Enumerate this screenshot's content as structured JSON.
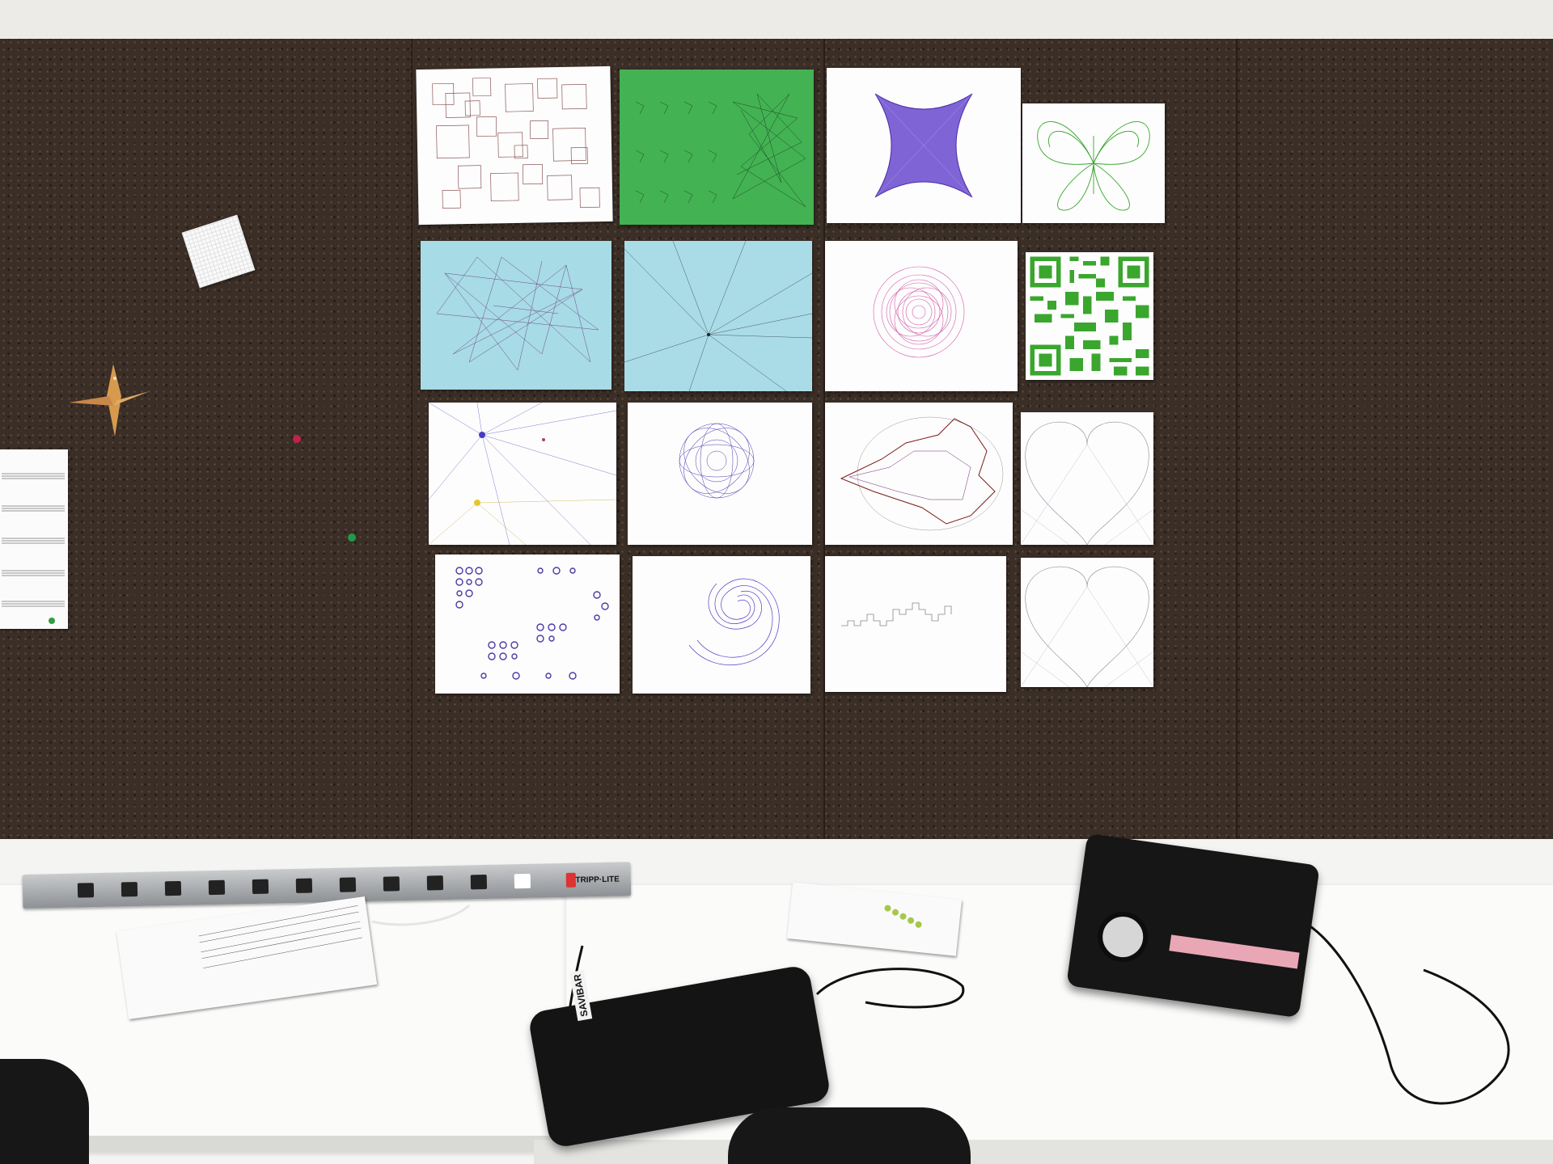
{
  "scene": {
    "powerstrip": {
      "brand": "TRIPP·LITE",
      "outlet_count": 12
    },
    "case_label": "SAVIBAR"
  },
  "colors": {
    "cork": "#3a2e26",
    "green_paper": "#43b253",
    "blue_paper": "#a7dbe6",
    "purple_ink": "#5b2db5",
    "pink_ink": "#d25aa8",
    "green_ink": "#3aa62e",
    "red_ink": "#7a1a1a"
  },
  "artworks": [
    {
      "name": "squares-grid"
    },
    {
      "name": "green-knight-lines"
    },
    {
      "name": "purple-astroid"
    },
    {
      "name": "green-butterfly"
    },
    {
      "name": "blue-network"
    },
    {
      "name": "blue-radial-lines"
    },
    {
      "name": "pink-spirograph"
    },
    {
      "name": "green-qr-code"
    },
    {
      "name": "multi-color-rays"
    },
    {
      "name": "circle-sphere"
    },
    {
      "name": "mandelbrot-outline"
    },
    {
      "name": "heart-string-art-1"
    },
    {
      "name": "dot-pattern"
    },
    {
      "name": "spiral-nautilus"
    },
    {
      "name": "dragon-curve"
    },
    {
      "name": "heart-string-art-2"
    }
  ]
}
